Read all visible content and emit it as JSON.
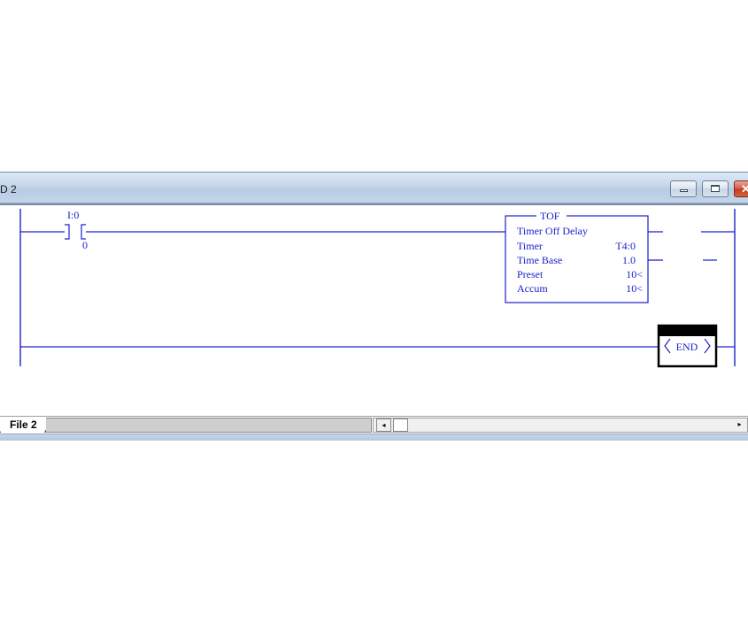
{
  "window": {
    "title": "D 2",
    "minimize_icon": "minimize-icon",
    "maximize_icon": "maximize-icon",
    "close_icon": "close-icon"
  },
  "ladder": {
    "rung0": {
      "contact": {
        "address": "I:0",
        "bit": "0"
      },
      "tof": {
        "mnemonic": "TOF",
        "description": "Timer Off Delay",
        "rows": [
          {
            "label": "Timer",
            "value": "T4:0"
          },
          {
            "label": "Time Base",
            "value": "1.0"
          },
          {
            "label": "Preset",
            "value": "10<"
          },
          {
            "label": "Accum",
            "value": "10<"
          }
        ]
      }
    },
    "rung1": {
      "end_label": "END"
    }
  },
  "tabs": {
    "active_tab": "File 2"
  },
  "scrollbar": {
    "left_arrow": "◂",
    "right_arrow": "▸"
  },
  "colors": {
    "ladder_blue": "#1b22c8"
  }
}
